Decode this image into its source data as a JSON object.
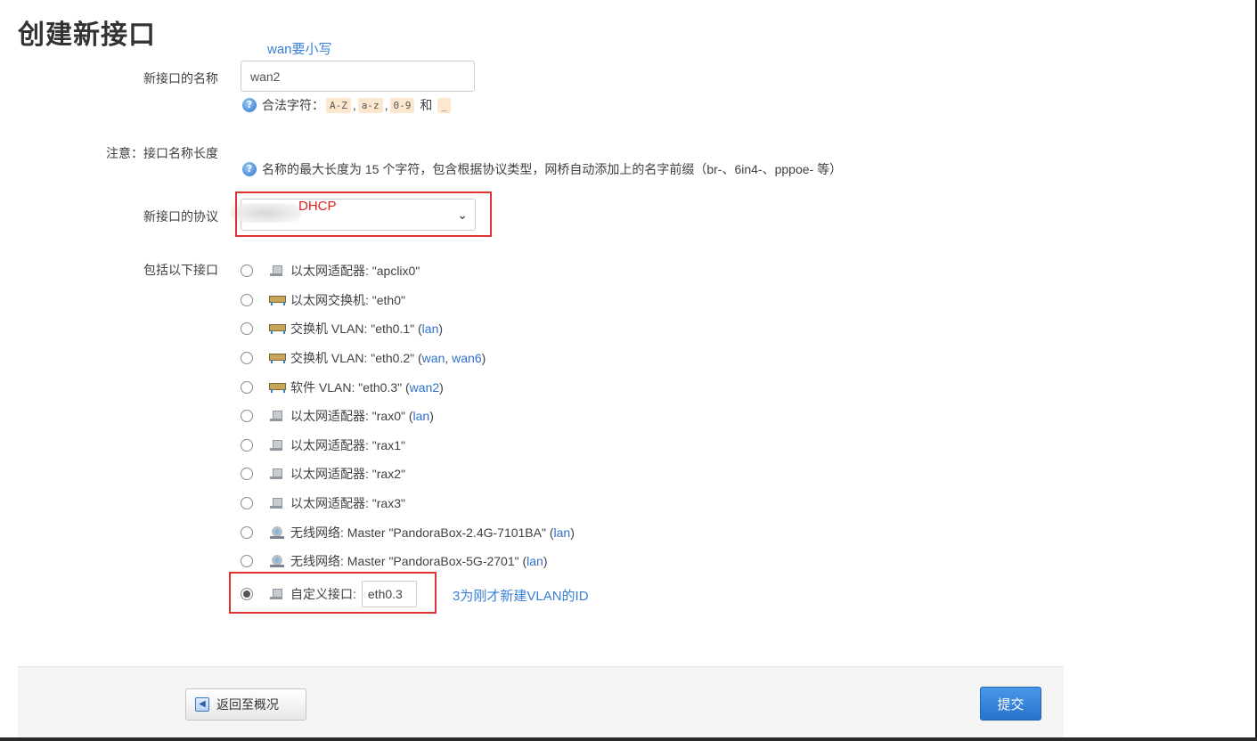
{
  "page": {
    "title": "创建新接口"
  },
  "annotations": {
    "name_note": "wan要小写",
    "protocol_note": "DHCP",
    "custom_note": "3为刚才新建VLAN的ID"
  },
  "form": {
    "name": {
      "label": "新接口的名称",
      "value": "wan2",
      "hint_prefix": "合法字符：",
      "chips": [
        "A-Z",
        "a-z",
        "0-9"
      ],
      "hint_and": "和",
      "chip_last": "_"
    },
    "length_note": {
      "label": "注意：接口名称长度",
      "hint": "名称的最大长度为 15 个字符，包含根据协议类型，网桥自动添加上的名字前缀（br-、6in4-、pppoe- 等）"
    },
    "protocol": {
      "label": "新接口的协议",
      "value": ""
    },
    "interfaces": {
      "label": "包括以下接口",
      "items": [
        {
          "icon": "ethernet-adapter-icon",
          "text": "以太网适配器: \"apclix0\"",
          "links": []
        },
        {
          "icon": "ethernet-switch-icon",
          "text": "以太网交换机: \"eth0\"",
          "links": []
        },
        {
          "icon": "ethernet-switch-icon",
          "text": "交换机 VLAN: \"eth0.1\"",
          "links": [
            "lan"
          ]
        },
        {
          "icon": "ethernet-switch-icon",
          "text": "交换机 VLAN: \"eth0.2\"",
          "links": [
            "wan",
            "wan6"
          ]
        },
        {
          "icon": "ethernet-switch-icon",
          "text": "软件 VLAN: \"eth0.3\"",
          "links": [
            "wan2"
          ]
        },
        {
          "icon": "ethernet-adapter-icon",
          "text": "以太网适配器: \"rax0\"",
          "links": [
            "lan"
          ]
        },
        {
          "icon": "ethernet-adapter-icon",
          "text": "以太网适配器: \"rax1\"",
          "links": []
        },
        {
          "icon": "ethernet-adapter-icon",
          "text": "以太网适配器: \"rax2\"",
          "links": []
        },
        {
          "icon": "ethernet-adapter-icon",
          "text": "以太网适配器: \"rax3\"",
          "links": []
        },
        {
          "icon": "wireless-icon",
          "text": "无线网络: Master \"PandoraBox-2.4G-7101BA\"",
          "links": [
            "lan"
          ]
        },
        {
          "icon": "wireless-icon",
          "text": "无线网络: Master \"PandoraBox-5G-2701\"",
          "links": [
            "lan"
          ]
        }
      ],
      "custom": {
        "icon": "ethernet-adapter-icon",
        "label": "自定义接口:",
        "value": "eth0.3",
        "checked": true
      }
    }
  },
  "footer": {
    "back_label": "返回至概况",
    "submit_label": "提交"
  }
}
